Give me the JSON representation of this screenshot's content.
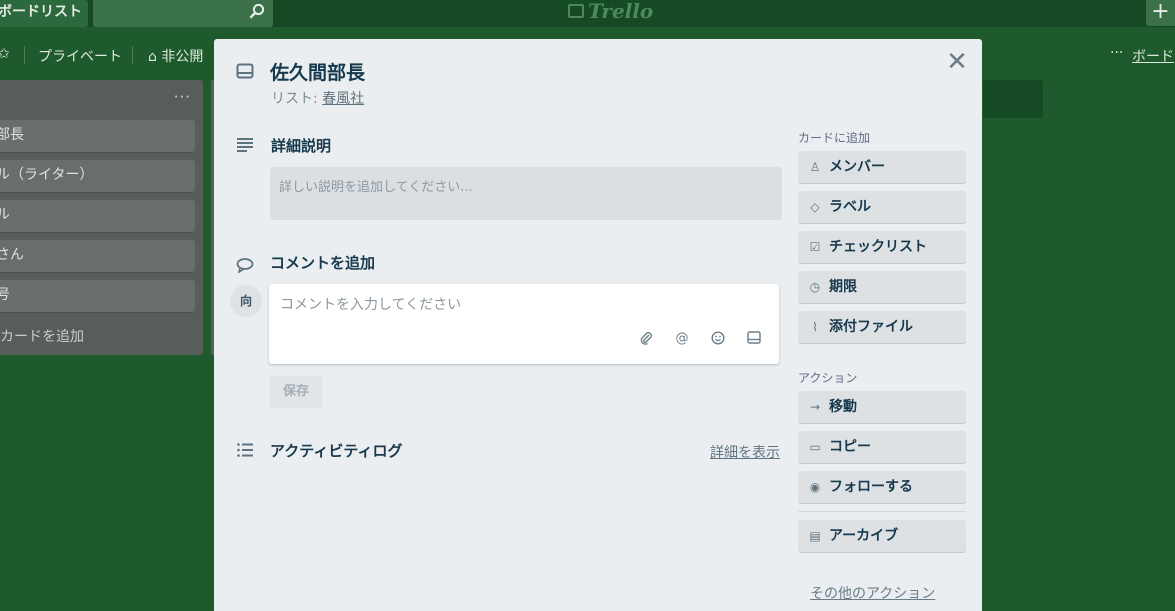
{
  "header": {
    "boards_label": "ボードリスト",
    "logo_text": "Trello",
    "plus_label": "+"
  },
  "board_bar": {
    "visibility": "プライベート",
    "permission": "非公開",
    "menu_dots": "···",
    "menu_link": "ボード"
  },
  "list": {
    "dots": "···",
    "cards": [
      "部長",
      "ル（ライター）",
      "ル",
      "さん",
      "号"
    ],
    "add_card": "カードを追加"
  },
  "modal": {
    "close": "✕",
    "title": "佐久間部長",
    "list_prefix": "リスト: ",
    "list_name": "春風社",
    "description": {
      "title": "詳細説明",
      "placeholder": "詳しい説明を追加してください..."
    },
    "comment": {
      "title": "コメントを追加",
      "avatar": "向",
      "placeholder": "コメントを入力してください",
      "save": "保存"
    },
    "activity": {
      "title": "アクティビティログ",
      "details_link": "詳細を表示"
    },
    "sidebar": {
      "add_heading": "カードに追加",
      "add_buttons": [
        "メンバー",
        "ラベル",
        "チェックリスト",
        "期限",
        "添付ファイル"
      ],
      "actions_heading": "アクション",
      "action_buttons": [
        "移動",
        "コピー",
        "フォローする"
      ],
      "archive": "アーカイブ",
      "other_actions": "その他のアクション"
    }
  },
  "colors": {
    "board_bg": "#1e5a2c",
    "modal_bg": "#ebeef0",
    "title": "#17394d"
  }
}
